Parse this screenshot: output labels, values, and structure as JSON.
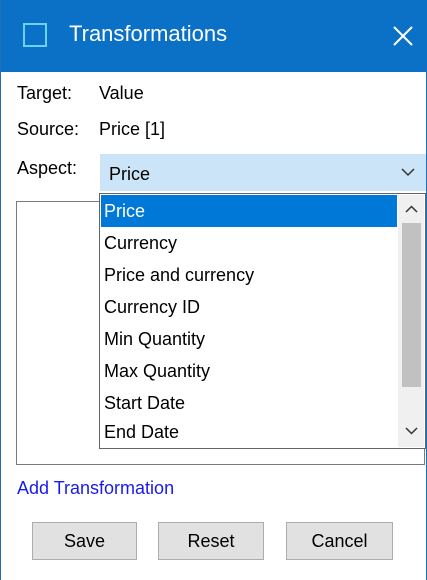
{
  "window": {
    "title": "Transformations",
    "title_bar_color": "#0a71c6"
  },
  "fields": {
    "target_label": "Target:",
    "target_value": "Value",
    "source_label": "Source:",
    "source_value": "Price [1]",
    "aspect_label": "Aspect:",
    "aspect_value": "Price"
  },
  "aspect_options": [
    "Price",
    "Currency",
    "Price and currency",
    "Currency ID",
    "Min Quantity",
    "Max Quantity",
    "Start Date",
    "End Date"
  ],
  "aspect_selected_index": 0,
  "add_transformation_label": "Add Transformation",
  "buttons": {
    "save": "Save",
    "reset": "Reset",
    "cancel": "Cancel"
  },
  "icons": {
    "window_icon": "window-icon",
    "close": "close-icon",
    "dropdown": "chevron-down-icon",
    "scroll_up": "chevron-up-icon",
    "scroll_down": "chevron-down-icon"
  },
  "colors": {
    "accent": "#0078d7",
    "select_bg": "#cce4f7",
    "link": "#1a1aee"
  }
}
